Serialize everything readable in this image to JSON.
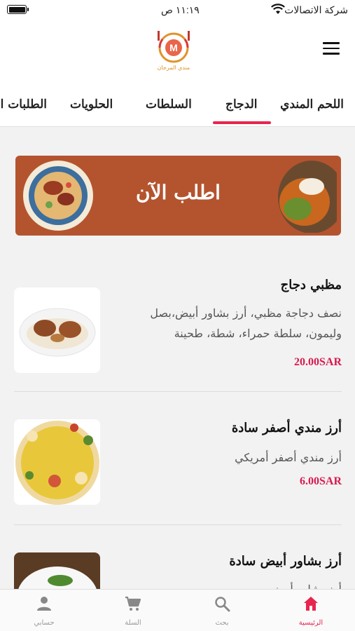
{
  "status_bar": {
    "carrier": "شركة الاتصالات",
    "time": "١١:١٩ ص"
  },
  "header": {
    "logo_text": "مندي المرجان",
    "logo_letter": "M"
  },
  "tabs": [
    {
      "label": "اللحم المندي"
    },
    {
      "label": "الدجاج",
      "active": true
    },
    {
      "label": "السلطات"
    },
    {
      "label": "الحلويات"
    },
    {
      "label": "الطلبات ا"
    }
  ],
  "banner": {
    "text": "اطلب الآن"
  },
  "items": [
    {
      "title": "مظبي دجاج",
      "description": "نصف دجاجة مظبي، أرز بشاور أبيض،بصل وليمون، سلطة حمراء، شطة، طحينة",
      "price": "20.00SAR"
    },
    {
      "title": "أرز مندي أصفر سادة",
      "description": "أرز مندي أصفر أمريكي",
      "price": "6.00SAR"
    },
    {
      "title": "أرز بشاور أبيض سادة",
      "description": "أرز بشاور أبيض",
      "price": ""
    }
  ],
  "bottom_nav": [
    {
      "label": "الرئيسية",
      "icon": "home-icon",
      "active": true
    },
    {
      "label": "بحث",
      "icon": "search-icon"
    },
    {
      "label": "السلة",
      "icon": "cart-icon"
    },
    {
      "label": "حسابي",
      "icon": "user-icon"
    }
  ],
  "colors": {
    "accent": "#e8254f",
    "price": "#d81b4f",
    "banner": "#b4542f",
    "logo": "#e0932a"
  }
}
